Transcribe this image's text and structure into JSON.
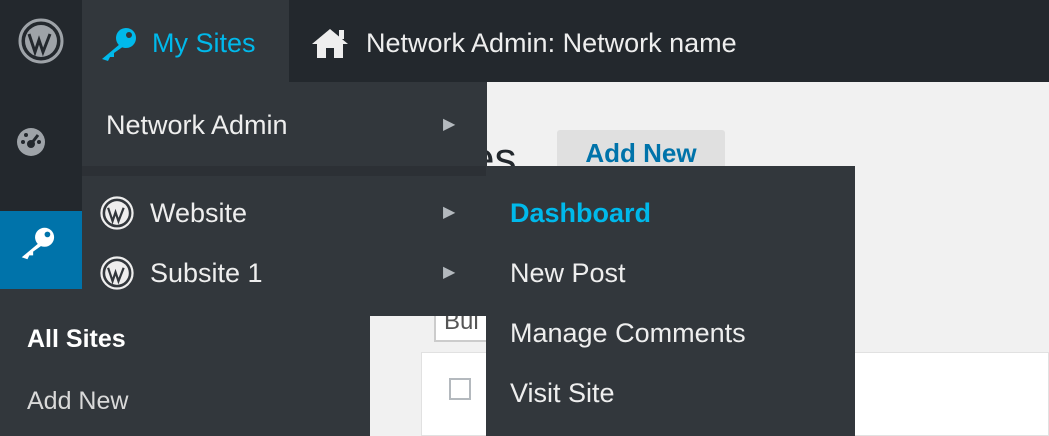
{
  "adminbar": {
    "my_sites_label": "My Sites",
    "network_title": "Network Admin: Network name"
  },
  "sidebar": {
    "submenu": {
      "all_sites": "All Sites",
      "add_new": "Add New"
    }
  },
  "content": {
    "title_fragment": "es",
    "add_new_button": "Add New",
    "bulk_fragment": "Bul"
  },
  "my_sites_menu": {
    "network_admin": "Network Admin",
    "sites": [
      {
        "label": "Website"
      },
      {
        "label": "Subsite 1"
      }
    ]
  },
  "site_submenu": {
    "items": [
      {
        "label": "Dashboard",
        "active": true
      },
      {
        "label": "New Post"
      },
      {
        "label": "Manage Comments"
      },
      {
        "label": "Visit Site"
      }
    ]
  },
  "colors": {
    "adminbar_bg": "#23282d",
    "menu_bg": "#32373c",
    "highlight": "#00b9eb",
    "active_sidebar": "#0073aa"
  }
}
